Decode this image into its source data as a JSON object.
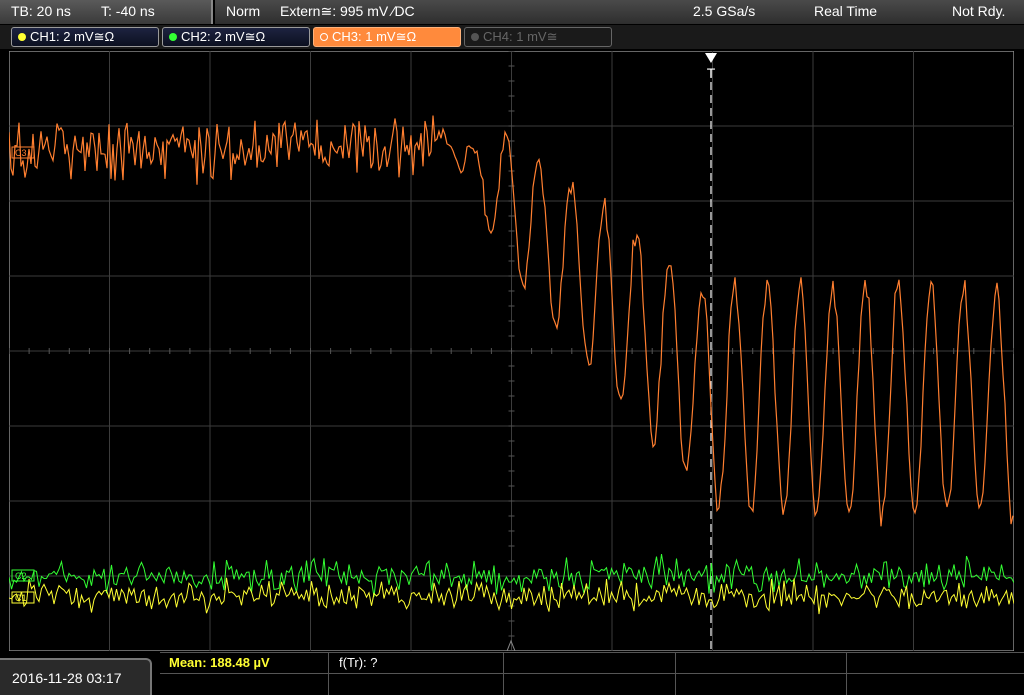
{
  "topbar": {
    "timebase": "TB: 20 ns",
    "trigger_time": "T: -40 ns",
    "mode": "Norm",
    "trigger": "Extern≅: 995 mV ∕DC",
    "sample_rate": "2.5 GSa/s",
    "acq_mode": "Real Time",
    "status": "Not Rdy."
  },
  "channels": [
    {
      "label": "CH1: 2 mV≅Ω",
      "color": "#ffff33"
    },
    {
      "label": "CH2: 2 mV≅Ω",
      "color": "#33ff33"
    },
    {
      "label": "CH3: 1 mV≅Ω",
      "color": "#ff8a3c"
    },
    {
      "label": "CH4: 1 mV≅",
      "color": "#777777"
    }
  ],
  "markers": {
    "trigger_marker": "T",
    "ch3_marker": "C3",
    "ch2_marker": "C2",
    "ch1_marker": "C1"
  },
  "bottom": {
    "datetime": "2016-11-28 03:17",
    "mean": "Mean: 188.48 µV",
    "f_tr": "f(Tr): ?"
  },
  "colors": {
    "ch1": "#ffff33",
    "ch2": "#33ff33",
    "ch3": "#ff7f30",
    "grid": "#444444"
  }
}
